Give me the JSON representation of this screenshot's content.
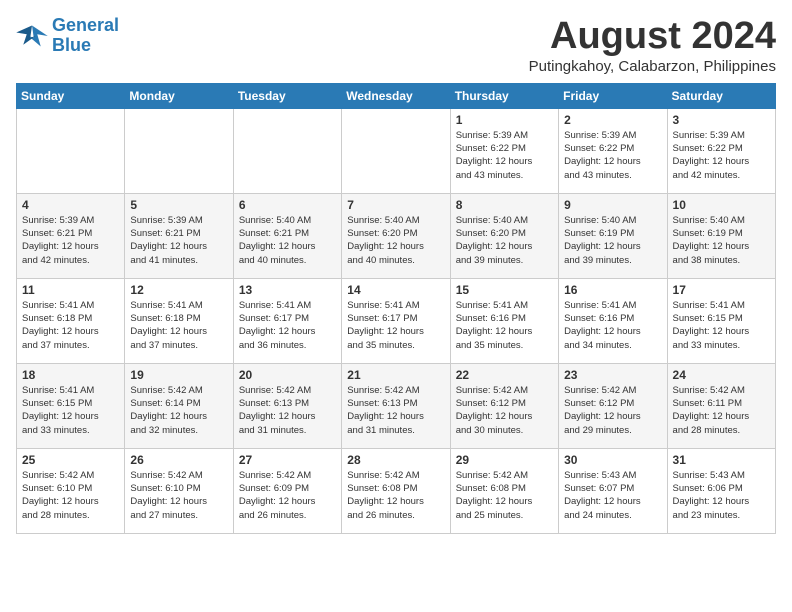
{
  "logo": {
    "line1": "General",
    "line2": "Blue"
  },
  "title": "August 2024",
  "location": "Putingkahoy, Calabarzon, Philippines",
  "days_of_week": [
    "Sunday",
    "Monday",
    "Tuesday",
    "Wednesday",
    "Thursday",
    "Friday",
    "Saturday"
  ],
  "weeks": [
    [
      {
        "day": "",
        "content": ""
      },
      {
        "day": "",
        "content": ""
      },
      {
        "day": "",
        "content": ""
      },
      {
        "day": "",
        "content": ""
      },
      {
        "day": "1",
        "content": "Sunrise: 5:39 AM\nSunset: 6:22 PM\nDaylight: 12 hours\nand 43 minutes."
      },
      {
        "day": "2",
        "content": "Sunrise: 5:39 AM\nSunset: 6:22 PM\nDaylight: 12 hours\nand 43 minutes."
      },
      {
        "day": "3",
        "content": "Sunrise: 5:39 AM\nSunset: 6:22 PM\nDaylight: 12 hours\nand 42 minutes."
      }
    ],
    [
      {
        "day": "4",
        "content": "Sunrise: 5:39 AM\nSunset: 6:21 PM\nDaylight: 12 hours\nand 42 minutes."
      },
      {
        "day": "5",
        "content": "Sunrise: 5:39 AM\nSunset: 6:21 PM\nDaylight: 12 hours\nand 41 minutes."
      },
      {
        "day": "6",
        "content": "Sunrise: 5:40 AM\nSunset: 6:21 PM\nDaylight: 12 hours\nand 40 minutes."
      },
      {
        "day": "7",
        "content": "Sunrise: 5:40 AM\nSunset: 6:20 PM\nDaylight: 12 hours\nand 40 minutes."
      },
      {
        "day": "8",
        "content": "Sunrise: 5:40 AM\nSunset: 6:20 PM\nDaylight: 12 hours\nand 39 minutes."
      },
      {
        "day": "9",
        "content": "Sunrise: 5:40 AM\nSunset: 6:19 PM\nDaylight: 12 hours\nand 39 minutes."
      },
      {
        "day": "10",
        "content": "Sunrise: 5:40 AM\nSunset: 6:19 PM\nDaylight: 12 hours\nand 38 minutes."
      }
    ],
    [
      {
        "day": "11",
        "content": "Sunrise: 5:41 AM\nSunset: 6:18 PM\nDaylight: 12 hours\nand 37 minutes."
      },
      {
        "day": "12",
        "content": "Sunrise: 5:41 AM\nSunset: 6:18 PM\nDaylight: 12 hours\nand 37 minutes."
      },
      {
        "day": "13",
        "content": "Sunrise: 5:41 AM\nSunset: 6:17 PM\nDaylight: 12 hours\nand 36 minutes."
      },
      {
        "day": "14",
        "content": "Sunrise: 5:41 AM\nSunset: 6:17 PM\nDaylight: 12 hours\nand 35 minutes."
      },
      {
        "day": "15",
        "content": "Sunrise: 5:41 AM\nSunset: 6:16 PM\nDaylight: 12 hours\nand 35 minutes."
      },
      {
        "day": "16",
        "content": "Sunrise: 5:41 AM\nSunset: 6:16 PM\nDaylight: 12 hours\nand 34 minutes."
      },
      {
        "day": "17",
        "content": "Sunrise: 5:41 AM\nSunset: 6:15 PM\nDaylight: 12 hours\nand 33 minutes."
      }
    ],
    [
      {
        "day": "18",
        "content": "Sunrise: 5:41 AM\nSunset: 6:15 PM\nDaylight: 12 hours\nand 33 minutes."
      },
      {
        "day": "19",
        "content": "Sunrise: 5:42 AM\nSunset: 6:14 PM\nDaylight: 12 hours\nand 32 minutes."
      },
      {
        "day": "20",
        "content": "Sunrise: 5:42 AM\nSunset: 6:13 PM\nDaylight: 12 hours\nand 31 minutes."
      },
      {
        "day": "21",
        "content": "Sunrise: 5:42 AM\nSunset: 6:13 PM\nDaylight: 12 hours\nand 31 minutes."
      },
      {
        "day": "22",
        "content": "Sunrise: 5:42 AM\nSunset: 6:12 PM\nDaylight: 12 hours\nand 30 minutes."
      },
      {
        "day": "23",
        "content": "Sunrise: 5:42 AM\nSunset: 6:12 PM\nDaylight: 12 hours\nand 29 minutes."
      },
      {
        "day": "24",
        "content": "Sunrise: 5:42 AM\nSunset: 6:11 PM\nDaylight: 12 hours\nand 28 minutes."
      }
    ],
    [
      {
        "day": "25",
        "content": "Sunrise: 5:42 AM\nSunset: 6:10 PM\nDaylight: 12 hours\nand 28 minutes."
      },
      {
        "day": "26",
        "content": "Sunrise: 5:42 AM\nSunset: 6:10 PM\nDaylight: 12 hours\nand 27 minutes."
      },
      {
        "day": "27",
        "content": "Sunrise: 5:42 AM\nSunset: 6:09 PM\nDaylight: 12 hours\nand 26 minutes."
      },
      {
        "day": "28",
        "content": "Sunrise: 5:42 AM\nSunset: 6:08 PM\nDaylight: 12 hours\nand 26 minutes."
      },
      {
        "day": "29",
        "content": "Sunrise: 5:42 AM\nSunset: 6:08 PM\nDaylight: 12 hours\nand 25 minutes."
      },
      {
        "day": "30",
        "content": "Sunrise: 5:43 AM\nSunset: 6:07 PM\nDaylight: 12 hours\nand 24 minutes."
      },
      {
        "day": "31",
        "content": "Sunrise: 5:43 AM\nSunset: 6:06 PM\nDaylight: 12 hours\nand 23 minutes."
      }
    ]
  ]
}
